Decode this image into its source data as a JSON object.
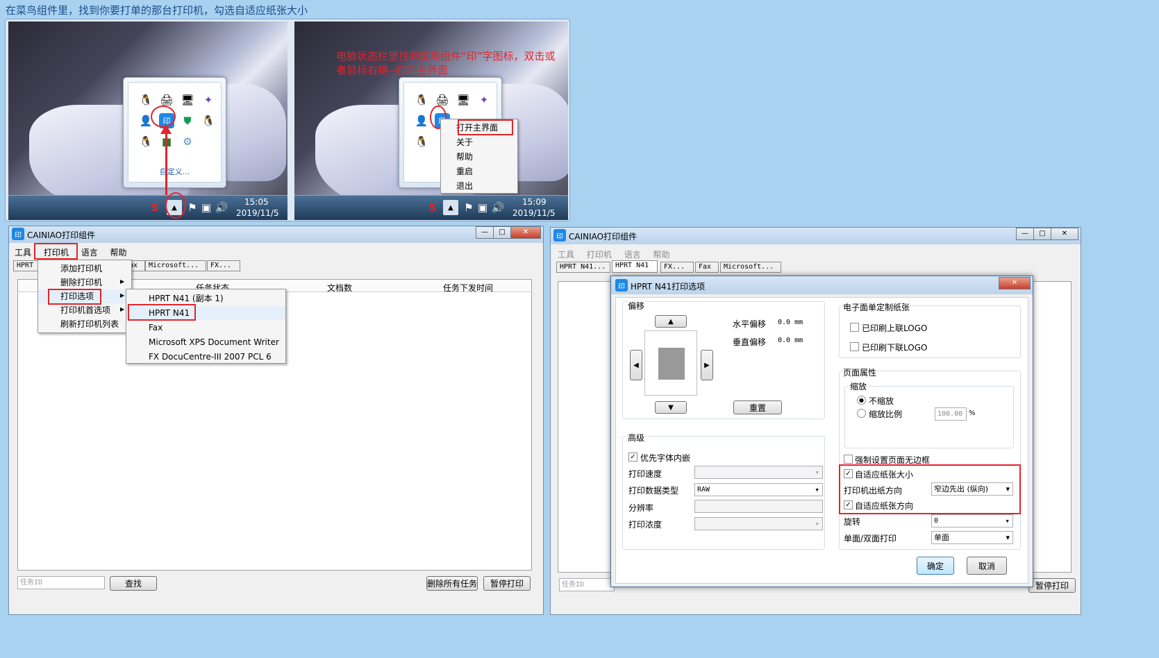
{
  "caption": "在菜鸟组件里，找到你要打单的那台打印机，勾选自适应纸张大小",
  "colors": {
    "highlight_red": "#e3242b",
    "annotation_red": "#e3242b"
  },
  "tray_left": {
    "customize": "自定义...",
    "time": "15:05",
    "date": "2019/11/5"
  },
  "tray_right": {
    "annotation": "电脑状态栏里找到菜鸟组件“印”字图标，双击或者鼠标右键--打开主界面",
    "time": "15:09",
    "date": "2019/11/5",
    "context_menu": [
      "打开主界面",
      "关于",
      "帮助",
      "重启",
      "退出"
    ]
  },
  "app_left": {
    "title": "CAINIAO打印组件",
    "menu": [
      "工具",
      "打印机",
      "语言",
      "帮助"
    ],
    "tabs": [
      "HPRT",
      "Microsoft...",
      "FX..."
    ],
    "printer_menu": [
      "添加打印机",
      "删除打印机",
      "打印选项",
      "打印机首选项",
      "刷新打印机列表"
    ],
    "submenu": [
      "HPRT N41 (副本 1)",
      "HPRT N41",
      "Fax",
      "Microsoft XPS Document Writer",
      "FX DocuCentre-III 2007 PCL 6"
    ],
    "columns": [
      "任务状态",
      "文档数",
      "任务下发时间"
    ],
    "task_id_placeholder": "任务ID",
    "find": "查找",
    "delete_all": "删除所有任务",
    "pause": "暂停打印"
  },
  "app_right": {
    "title": "CAINIAO打印组件",
    "menu": [
      "工具",
      "打印机",
      "语言",
      "帮助"
    ],
    "tabs": [
      "HPRT N41...",
      "HPRT N41",
      "FX...",
      "Fax",
      "Microsoft..."
    ],
    "task_id_placeholder": "任务ID",
    "pause": "暂停打印"
  },
  "dialog": {
    "title": "HPRT N41打印选项",
    "offset": {
      "label": "偏移",
      "h_label": "水平偏移",
      "h_value": "0.0 mm",
      "v_label": "垂直偏移",
      "v_value": "0.0 mm",
      "reset": "重置"
    },
    "advanced": {
      "label": "高级",
      "embed_font": "优先字体内嵌",
      "speed": "打印速度",
      "data_type": "打印数据类型",
      "data_type_value": "RAW",
      "resolution": "分辨率",
      "density": "打印浓度"
    },
    "waybill": {
      "label": "电子面单定制纸张",
      "upper_logo": "已印刷上联LOGO",
      "lower_logo": "已印刷下联LOGO"
    },
    "page": {
      "label": "页面属性",
      "scale": "缩放",
      "no_scale": "不缩放",
      "scale_ratio": "缩放比例",
      "scale_value": "100.00",
      "percent": "%",
      "no_border": "强制设置页面无边框",
      "adaptive_size": "自适应纸张大小",
      "direction": "打印机出纸方向",
      "direction_value": "窄边先出 (纵向)",
      "adaptive_dir": "自适应纸张方向",
      "rotate": "旋转",
      "rotate_value": "0",
      "duplex": "单面/双面打印",
      "duplex_value": "单面"
    },
    "ok": "确定",
    "cancel": "取消"
  }
}
